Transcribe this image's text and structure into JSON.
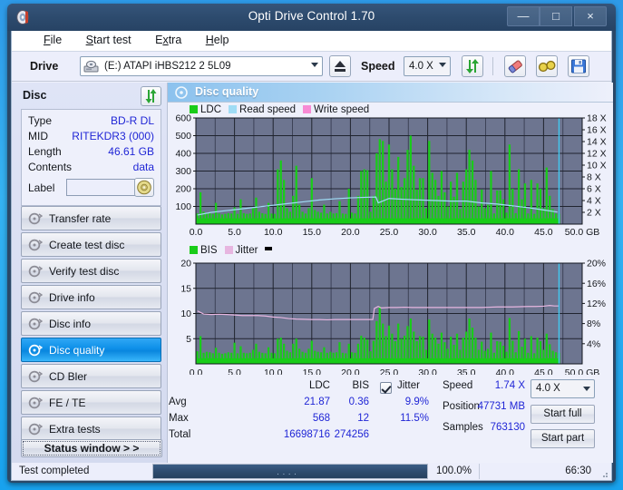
{
  "window": {
    "title": "Opti Drive Control 1.70",
    "icon": "disc-icon",
    "minimize": "—",
    "maximize": "□",
    "close": "×"
  },
  "menubar": {
    "items": [
      {
        "label": "File",
        "accel": "F"
      },
      {
        "label": "Start test",
        "accel": "S"
      },
      {
        "label": "Extra",
        "accel": "x"
      },
      {
        "label": "Help",
        "accel": "H"
      }
    ]
  },
  "toolbar": {
    "drive_label": "Drive",
    "drive_value": "(E:)  ATAPI iHBS212  2 5L09",
    "eject_icon": "eject-icon",
    "speed_label": "Speed",
    "speed_value": "4.0 X",
    "refresh_icon": "refresh-icon",
    "erase_icon": "eraser-icon",
    "spectacle_icon": "glasses-icon",
    "save_icon": "save-icon"
  },
  "disc": {
    "title": "Disc",
    "refresh_icon": "refresh-icon",
    "rows": [
      {
        "key": "Type",
        "value": "BD-R DL"
      },
      {
        "key": "MID",
        "value": "RITEKDR3 (000)"
      },
      {
        "key": "Length",
        "value": "46.61 GB"
      },
      {
        "key": "Contents",
        "value": "data"
      }
    ],
    "label_key": "Label",
    "label_value": "",
    "label_placeholder": "",
    "label_button_icon": "disc-icon"
  },
  "sidebar": {
    "items": [
      {
        "label": "Transfer rate",
        "icon": "disc-transfer-icon",
        "selected": false
      },
      {
        "label": "Create test disc",
        "icon": "disc-create-icon",
        "selected": false
      },
      {
        "label": "Verify test disc",
        "icon": "disc-verify-icon",
        "selected": false
      },
      {
        "label": "Drive info",
        "icon": "drive-info-icon",
        "selected": false
      },
      {
        "label": "Disc info",
        "icon": "disc-info-icon",
        "selected": false
      },
      {
        "label": "Disc quality",
        "icon": "disc-quality-icon",
        "selected": true
      },
      {
        "label": "CD Bler",
        "icon": "cd-bler-icon",
        "selected": false
      },
      {
        "label": "FE / TE",
        "icon": "fe-te-icon",
        "selected": false
      },
      {
        "label": "Extra tests",
        "icon": "extra-tests-icon",
        "selected": false
      }
    ],
    "status_window": "Status window > >"
  },
  "panel": {
    "header_title": "Disc quality",
    "header_icon": "disc-quality-icon"
  },
  "chart_data": [
    {
      "type": "area",
      "title": "LDC / Read speed",
      "xlabel": "GB",
      "ylabel": "LDC",
      "xlim": [
        0,
        50
      ],
      "ylim": [
        0,
        600
      ],
      "y2lim": [
        0,
        18
      ],
      "grid": true,
      "legend_position": "top-left",
      "xticks": [
        "0.0",
        "5.0",
        "10.0",
        "15.0",
        "20.0",
        "25.0",
        "30.0",
        "35.0",
        "40.0",
        "45.0",
        "50.0 GB"
      ],
      "yticks": [
        "100",
        "200",
        "300",
        "400",
        "500",
        "600"
      ],
      "y2ticks": [
        "2 X",
        "4 X",
        "6 X",
        "8 X",
        "10 X",
        "12 X",
        "14 X",
        "16 X",
        "18 X"
      ],
      "legend": [
        {
          "name": "LDC",
          "color": "#19cc19"
        },
        {
          "name": "Read speed",
          "color": "#9fdcf5"
        },
        {
          "name": "Write speed",
          "color": "#f78ad4"
        }
      ],
      "series": [
        {
          "name": "LDC",
          "color": "#19cc19",
          "x": [
            0.2,
            0.6,
            1.0,
            1.4,
            1.8,
            2.2,
            2.6,
            3.0,
            3.4,
            3.8,
            4.2,
            4.6,
            5.0,
            5.4,
            5.8,
            6.2,
            6.6,
            7.0,
            7.4,
            7.8,
            8.2,
            8.6,
            9.0,
            9.4,
            9.8,
            10.2,
            10.6,
            11.0,
            11.4,
            11.8,
            12.2,
            12.6,
            13.0,
            13.4,
            13.8,
            14.2,
            14.6,
            15.0,
            15.4,
            15.8,
            16.2,
            16.6,
            17.0,
            17.4,
            17.8,
            18.2,
            18.6,
            19.0,
            19.4,
            19.8,
            20.2,
            20.6,
            21.0,
            21.4,
            21.8,
            22.2,
            22.6,
            23.0,
            23.4,
            23.8,
            24.2,
            24.6,
            25.0,
            25.4,
            25.8,
            26.2,
            26.6,
            27.0,
            27.4,
            27.8,
            28.2,
            28.6,
            29.0,
            29.4,
            29.8,
            30.2,
            30.6,
            31.0,
            31.4,
            31.8,
            32.2,
            32.6,
            33.0,
            33.4,
            33.8,
            34.2,
            34.6,
            35.0,
            35.4,
            35.8,
            36.2,
            36.6,
            37.0,
            37.4,
            37.8,
            38.2,
            38.6,
            39.0,
            39.4,
            39.8,
            40.2,
            40.6,
            41.0,
            41.4,
            41.8,
            42.2,
            42.6,
            43.0,
            43.4,
            43.8,
            44.2,
            44.6,
            45.0,
            45.4,
            45.8,
            46.2,
            46.6,
            47.0
          ],
          "values": [
            60,
            180,
            70,
            62,
            65,
            58,
            120,
            60,
            55,
            58,
            62,
            60,
            95,
            58,
            140,
            62,
            58,
            60,
            90,
            150,
            70,
            62,
            58,
            120,
            60,
            58,
            310,
            360,
            250,
            90,
            70,
            160,
            330,
            110,
            70,
            60,
            90,
            260,
            80,
            70,
            65,
            110,
            60,
            70,
            60,
            62,
            130,
            60,
            58,
            200,
            65,
            60,
            160,
            300,
            310,
            305,
            70,
            160,
            400,
            480,
            470,
            240,
            450,
            310,
            200,
            380,
            210,
            260,
            420,
            500,
            330,
            195,
            260,
            260,
            90,
            470,
            290,
            250,
            160,
            300,
            180,
            100,
            240,
            155,
            290,
            85,
            240,
            310,
            420,
            360,
            250,
            100,
            195,
            90,
            110,
            300,
            60,
            190,
            190,
            140,
            65,
            450,
            200,
            62,
            310,
            140,
            230,
            60,
            250,
            58,
            230,
            200,
            90,
            320,
            160,
            85,
            60,
            58
          ]
        },
        {
          "name": "Read speed",
          "color": "#9fdcf5",
          "x": [
            0.2,
            2.0,
            4.0,
            6.0,
            8.0,
            10.0,
            12.0,
            14.0,
            16.0,
            18.0,
            20.0,
            22.0,
            23.3,
            23.6,
            25.0,
            27.0,
            29.0,
            31.0,
            33.0,
            35.0,
            37.0,
            39.0,
            41.0,
            43.0,
            45.0,
            46.8
          ],
          "values": [
            1.55,
            2.0,
            2.3,
            2.6,
            2.9,
            3.2,
            3.5,
            3.8,
            4.1,
            4.3,
            4.45,
            4.55,
            4.6,
            3.6,
            4.35,
            4.2,
            4.1,
            4.0,
            3.9,
            3.9,
            3.6,
            3.4,
            3.1,
            2.8,
            2.4,
            2.05
          ]
        }
      ],
      "end_marker_x": 47.0,
      "end_marker_color": "#41c9f0"
    },
    {
      "type": "area",
      "title": "BIS / Jitter",
      "xlabel": "GB",
      "ylabel": "BIS",
      "xlim": [
        0,
        50
      ],
      "ylim": [
        0,
        20
      ],
      "y2lim": [
        0,
        20
      ],
      "grid": true,
      "legend_position": "top-left",
      "xticks": [
        "0.0",
        "5.0",
        "10.0",
        "15.0",
        "20.0",
        "25.0",
        "30.0",
        "35.0",
        "40.0",
        "45.0",
        "50.0 GB"
      ],
      "yticks": [
        "5",
        "10",
        "15",
        "20"
      ],
      "y2ticks": [
        "4%",
        "8%",
        "12%",
        "16%",
        "20%"
      ],
      "legend": [
        {
          "name": "BIS",
          "color": "#19cc19"
        },
        {
          "name": "Jitter",
          "color": "#e7b6e0"
        }
      ],
      "series": [
        {
          "name": "BIS",
          "color": "#19cc19",
          "x": [
            0.2,
            0.6,
            1.0,
            1.4,
            1.8,
            2.2,
            2.6,
            3.0,
            3.4,
            3.8,
            4.2,
            4.6,
            5.0,
            5.4,
            5.8,
            6.2,
            6.6,
            7.0,
            7.4,
            7.8,
            8.2,
            8.6,
            9.0,
            9.4,
            9.8,
            10.2,
            10.6,
            11.0,
            11.4,
            11.8,
            12.2,
            12.6,
            13.0,
            13.4,
            13.8,
            14.2,
            14.6,
            15.0,
            15.4,
            15.8,
            16.2,
            16.6,
            17.0,
            17.4,
            17.8,
            18.2,
            18.6,
            19.0,
            19.4,
            19.8,
            20.2,
            20.6,
            21.0,
            21.4,
            21.8,
            22.2,
            22.6,
            23.0,
            23.4,
            23.8,
            24.2,
            24.6,
            25.0,
            25.4,
            25.8,
            26.2,
            26.6,
            27.0,
            27.4,
            27.8,
            28.2,
            28.6,
            29.0,
            29.4,
            29.8,
            30.2,
            30.6,
            31.0,
            31.4,
            31.8,
            32.2,
            32.6,
            33.0,
            33.4,
            33.8,
            34.2,
            34.6,
            35.0,
            35.4,
            35.8,
            36.2,
            36.6,
            37.0,
            37.4,
            37.8,
            38.2,
            38.6,
            39.0,
            39.4,
            39.8,
            40.2,
            40.6,
            41.0,
            41.4,
            41.8,
            42.2,
            42.6,
            43.0,
            43.4,
            43.8,
            44.2,
            44.6,
            45.0,
            45.4,
            45.8,
            46.2,
            46.6,
            47.0
          ],
          "values": [
            2.5,
            5.5,
            2.2,
            2.4,
            2.3,
            2.1,
            3.2,
            2.2,
            2.0,
            2.1,
            2.3,
            2.2,
            4.2,
            2.1,
            3.5,
            2.2,
            2.1,
            2.2,
            2.8,
            4.0,
            2.4,
            2.2,
            2.1,
            3.3,
            2.2,
            2.1,
            5.0,
            5.2,
            4.0,
            2.6,
            2.3,
            4.0,
            5.0,
            3.0,
            2.4,
            2.2,
            3.0,
            4.6,
            2.6,
            2.4,
            2.3,
            3.3,
            2.2,
            2.4,
            2.2,
            2.3,
            4.3,
            2.2,
            2.1,
            4.0,
            2.3,
            2.2,
            4.0,
            5.6,
            5.2,
            4.8,
            2.5,
            4.6,
            8.5,
            11.4,
            8.0,
            5.5,
            7.6,
            6.0,
            4.5,
            8.0,
            5.0,
            5.6,
            7.5,
            9.0,
            6.4,
            4.5,
            5.5,
            5.4,
            2.8,
            8.8,
            6.0,
            5.2,
            4.0,
            6.2,
            4.3,
            3.0,
            5.4,
            3.8,
            6.0,
            2.8,
            5.2,
            6.4,
            9.0,
            7.2,
            5.2,
            2.8,
            4.4,
            2.6,
            3.0,
            6.2,
            2.2,
            4.5,
            4.4,
            3.6,
            2.4,
            9.1,
            4.6,
            2.3,
            6.5,
            3.4,
            5.0,
            2.2,
            5.5,
            2.1,
            5.2,
            4.5,
            2.8,
            6.0,
            3.9,
            2.6,
            2.3,
            2.2
          ]
        },
        {
          "name": "Jitter",
          "color": "#e7b6e0",
          "x": [
            0.2,
            1.0,
            2.0,
            3.0,
            4.0,
            5.0,
            6.0,
            7.0,
            8.0,
            9.0,
            10.0,
            11.0,
            12.0,
            13.0,
            14.0,
            15.0,
            16.0,
            17.0,
            18.0,
            19.0,
            20.0,
            21.0,
            22.0,
            22.9,
            23.1,
            23.6,
            24.0,
            25.0,
            26.0,
            27.0,
            28.0,
            29.0,
            30.0,
            31.0,
            32.0,
            33.0,
            34.0,
            35.0,
            36.0,
            37.0,
            38.0,
            39.0,
            40.0,
            41.0,
            42.0,
            43.0,
            44.0,
            45.0,
            45.8,
            46.4,
            47.0
          ],
          "values": [
            10.5,
            9.9,
            9.8,
            9.85,
            9.8,
            9.7,
            9.6,
            9.6,
            9.6,
            9.5,
            9.3,
            9.2,
            9.0,
            8.9,
            8.85,
            8.8,
            8.8,
            8.75,
            8.8,
            8.8,
            8.8,
            8.8,
            8.8,
            8.8,
            11.0,
            11.4,
            11.1,
            11.2,
            11.2,
            11.25,
            11.2,
            11.2,
            11.2,
            11.2,
            11.2,
            11.2,
            11.2,
            11.2,
            11.2,
            11.2,
            11.25,
            11.3,
            11.3,
            11.3,
            11.35,
            11.4,
            11.4,
            11.45,
            11.6,
            11.5,
            11.5
          ]
        }
      ],
      "end_marker_x": 47.0,
      "end_marker_color": "#41c9f0"
    }
  ],
  "stats": {
    "col_ldc": "LDC",
    "col_bis": "BIS",
    "col_jitter": "Jitter",
    "jitter_checked": true,
    "row_avg": "Avg",
    "row_max": "Max",
    "row_total": "Total",
    "ldc_avg": "21.87",
    "ldc_max": "568",
    "ldc_total": "16698716",
    "bis_avg": "0.36",
    "bis_max": "12",
    "bis_total": "274256",
    "jitter_avg": "9.9%",
    "jitter_max": "11.5%",
    "speed_label": "Speed",
    "speed_value": "1.74 X",
    "position_label": "Position",
    "position_value": "47731 MB",
    "samples_label": "Samples",
    "samples_value": "763130",
    "speed_select": "4.0 X",
    "start_full": "Start full",
    "start_part": "Start part"
  },
  "statusbar": {
    "message": "Test completed",
    "progress_percent": "100.0%",
    "progress_value": 100,
    "elapsed": "66:30"
  }
}
